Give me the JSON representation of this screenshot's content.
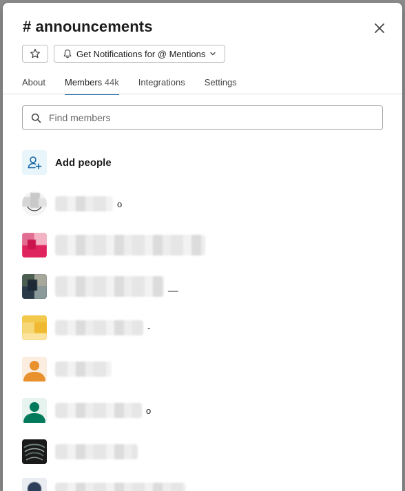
{
  "channel": {
    "title": "# announcements"
  },
  "actions": {
    "star_icon": "star-icon",
    "notifications_label": "Get Notifications for @ Mentions"
  },
  "tabs": [
    {
      "label": "About",
      "active": false
    },
    {
      "label": "Members",
      "count": "44k",
      "active": true
    },
    {
      "label": "Integrations",
      "active": false
    },
    {
      "label": "Settings",
      "active": false
    }
  ],
  "search": {
    "placeholder": "Find members",
    "value": ""
  },
  "add_people": {
    "label": "Add people"
  },
  "members": [
    {
      "name_tail": "o",
      "avatar": "blurred-photo"
    },
    {
      "name_tail": "",
      "avatar": "blurred-photo"
    },
    {
      "name_tail": "__",
      "avatar": "blurred-photo"
    },
    {
      "name_tail": "-",
      "avatar": "blurred-photo"
    },
    {
      "name_tail": "",
      "avatar": "default-avatar",
      "avatar_color": "#e8912d"
    },
    {
      "name_tail": "o",
      "avatar": "default-avatar",
      "avatar_color": "#007a5a"
    },
    {
      "name_tail": "",
      "avatar": "dark-photo"
    },
    {
      "name_tail": "",
      "avatar": "blurred-photo"
    }
  ],
  "colors": {
    "accent": "#1264a3",
    "text": "#1d1c1d",
    "muted": "#616061"
  }
}
